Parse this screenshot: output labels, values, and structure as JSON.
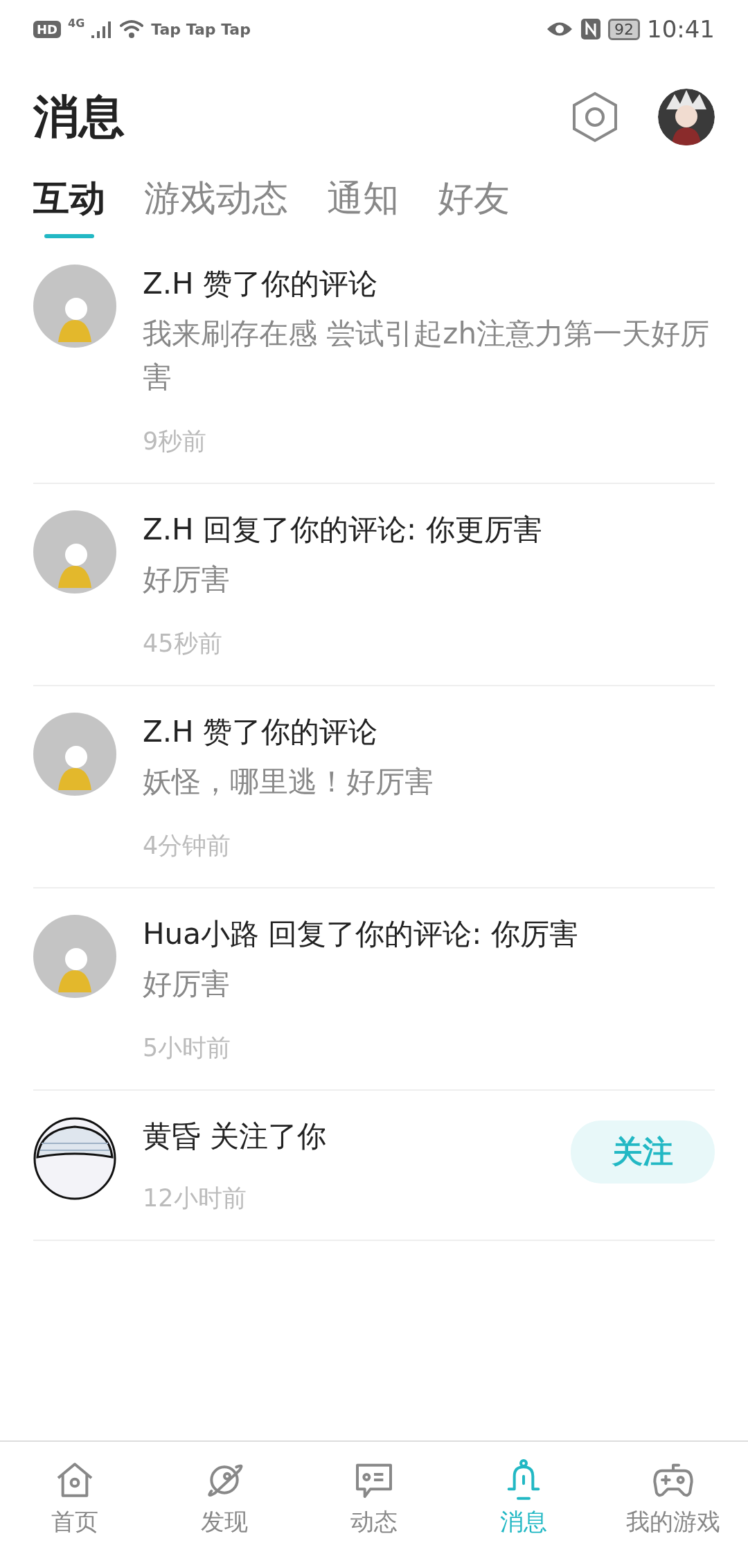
{
  "status_bar": {
    "hd": "HD",
    "network": "4G",
    "notifications": "Tap Tap Tap",
    "battery": "92",
    "time": "10:41"
  },
  "header": {
    "title": "消息"
  },
  "tabs": [
    {
      "label": "互动",
      "selected": true
    },
    {
      "label": "游戏动态",
      "selected": false
    },
    {
      "label": "通知",
      "selected": false
    },
    {
      "label": "好友",
      "selected": false
    }
  ],
  "messages": [
    {
      "title": "Z.H 赞了你的评论",
      "body": "我来刷存在感 尝试引起zh注意力第一天好厉害",
      "time": "9秒前"
    },
    {
      "title": "Z.H 回复了你的评论: 你更厉害",
      "body": "好厉害",
      "time": "45秒前"
    },
    {
      "title": "Z.H 赞了你的评论",
      "body": "妖怪，哪里逃！好厉害",
      "time": "4分钟前"
    },
    {
      "title": "Hua小路 回复了你的评论: 你厉害",
      "body": "好厉害",
      "time": "5小时前"
    },
    {
      "title": "黄昏 关注了你",
      "time": "12小时前",
      "button": "关注"
    }
  ],
  "bottom_nav": [
    {
      "label": "首页",
      "kind": "home",
      "selected": false
    },
    {
      "label": "发现",
      "kind": "planet",
      "selected": false
    },
    {
      "label": "动态",
      "kind": "chat",
      "selected": false
    },
    {
      "label": "消息",
      "kind": "bell",
      "selected": true
    },
    {
      "label": "我的游戏",
      "kind": "gamepad",
      "selected": false
    }
  ]
}
